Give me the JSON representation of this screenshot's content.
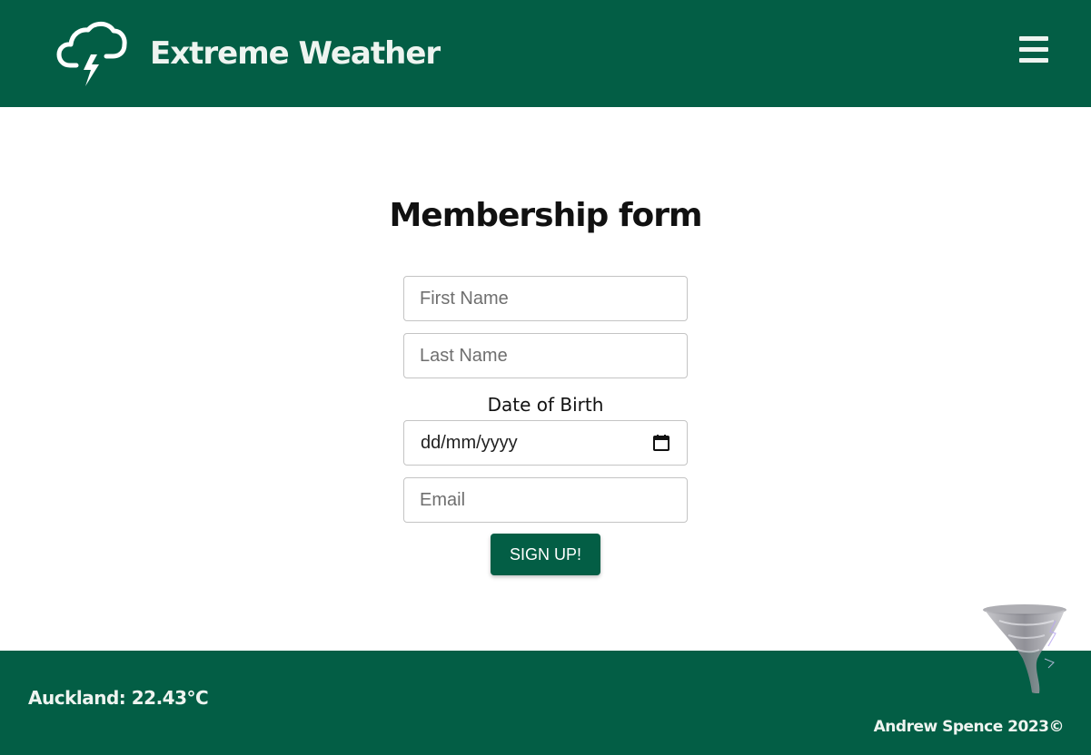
{
  "header": {
    "title": "Extreme Weather",
    "logo_icon": "storm-cloud-icon",
    "menu_icon": "hamburger-menu-icon",
    "background_color": "#035e45",
    "text_color": "#eef4f0"
  },
  "main": {
    "title": "Membership form",
    "fields": {
      "first_name_placeholder": "First Name",
      "last_name_placeholder": "Last Name",
      "dob_label": "Date of Birth",
      "dob_value": "dd/mm/yyyy",
      "email_placeholder": "Email"
    },
    "calendar_icon": "calendar-icon",
    "submit_label": "SIGN UP!",
    "accent_color": "#035e45"
  },
  "footer": {
    "weather": "Auckland: 22.43°C",
    "copyright": "Andrew Spence 2023©",
    "decoration_icon": "tornado-icon"
  }
}
